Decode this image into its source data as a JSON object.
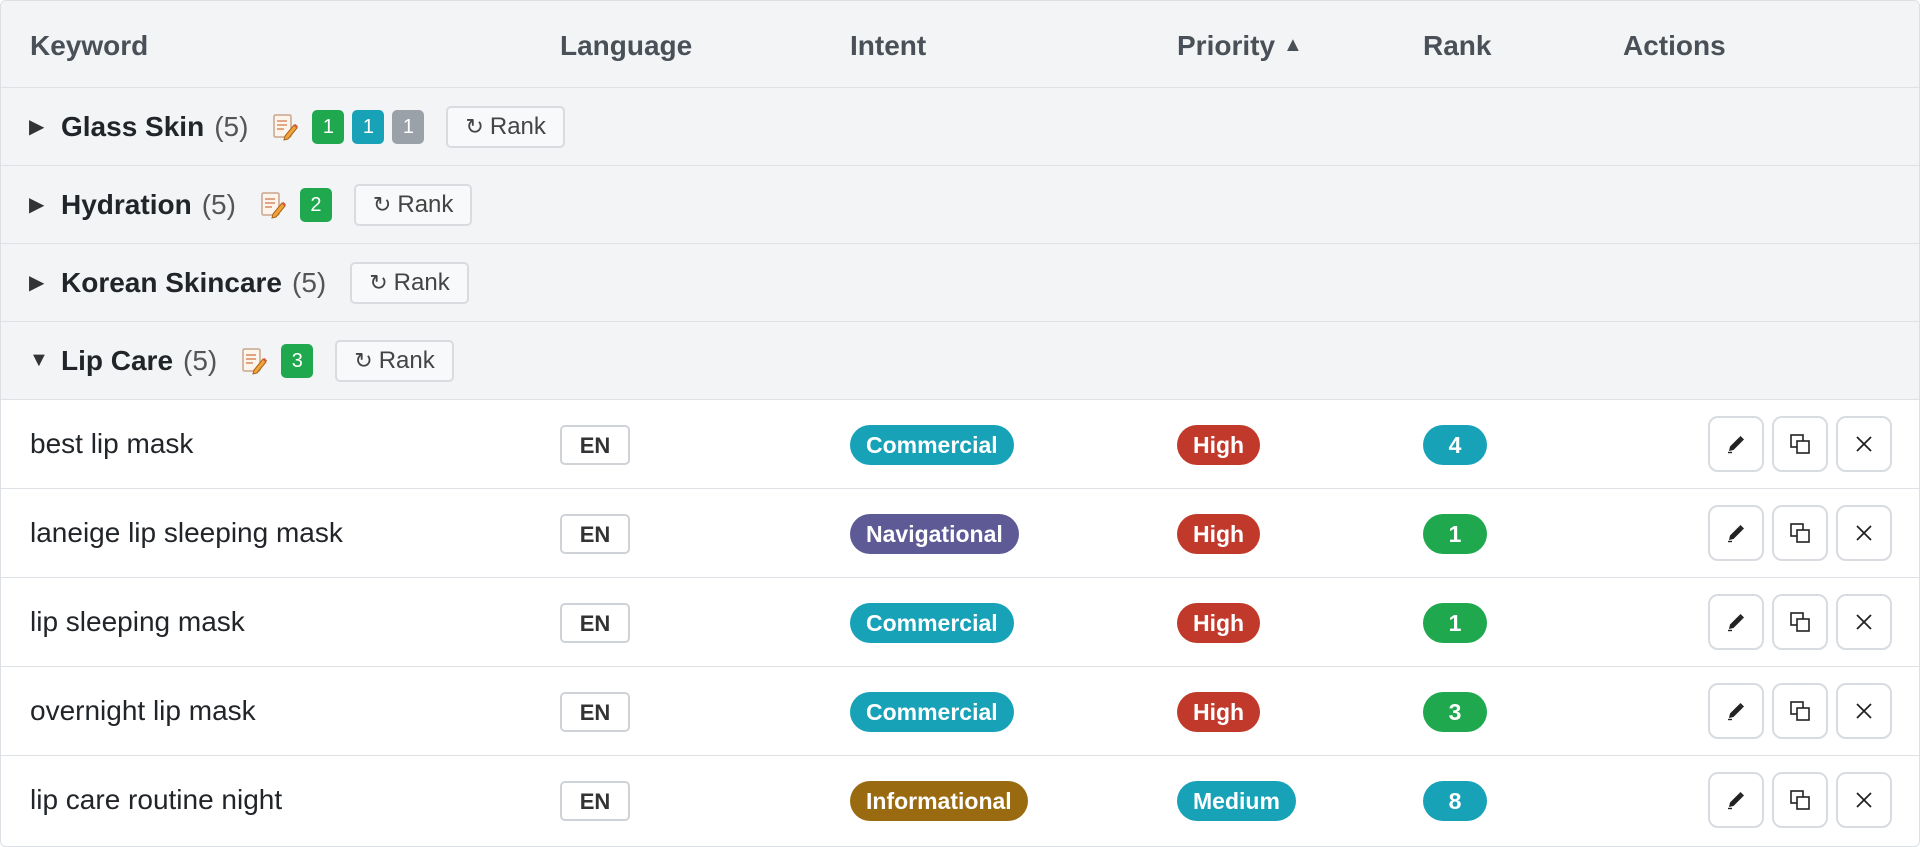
{
  "header": {
    "keyword": "Keyword",
    "language": "Language",
    "intent": "Intent",
    "priority": "Priority",
    "priority_sort_icon": "▲",
    "rank": "Rank",
    "actions": "Actions"
  },
  "groups": [
    {
      "name": "Glass Skin",
      "count": "(5)",
      "expanded": false,
      "caret": "▶",
      "rank_label": "Rank",
      "badges": [
        {
          "value": "1",
          "color": "#1fa84e"
        },
        {
          "value": "1",
          "color": "#17a2b8"
        },
        {
          "value": "1",
          "color": "#9aa1a8"
        }
      ]
    },
    {
      "name": "Hydration",
      "count": "(5)",
      "expanded": false,
      "caret": "▶",
      "rank_label": "Rank",
      "badges": [
        {
          "value": "2",
          "color": "#1fa84e"
        }
      ]
    },
    {
      "name": "Korean Skincare",
      "count": "(5)",
      "expanded": false,
      "caret": "▶",
      "rank_label": "Rank",
      "badges": []
    },
    {
      "name": "Lip Care",
      "count": "(5)",
      "expanded": true,
      "caret": "▼",
      "rank_label": "Rank",
      "badges": [
        {
          "value": "3",
          "color": "#1fa84e"
        }
      ]
    }
  ],
  "rows": [
    {
      "keyword": "best lip mask",
      "language": "EN",
      "intent": "Commercial",
      "intent_color": "#17a2b8",
      "priority": "High",
      "priority_color": "#c0392b",
      "rank": "4",
      "rank_color": "#17a2b8"
    },
    {
      "keyword": "laneige lip sleeping mask",
      "language": "EN",
      "intent": "Navigational",
      "intent_color": "#5e5a96",
      "priority": "High",
      "priority_color": "#c0392b",
      "rank": "1",
      "rank_color": "#1fa84e"
    },
    {
      "keyword": "lip sleeping mask",
      "language": "EN",
      "intent": "Commercial",
      "intent_color": "#17a2b8",
      "priority": "High",
      "priority_color": "#c0392b",
      "rank": "1",
      "rank_color": "#1fa84e"
    },
    {
      "keyword": "overnight lip mask",
      "language": "EN",
      "intent": "Commercial",
      "intent_color": "#17a2b8",
      "priority": "High",
      "priority_color": "#c0392b",
      "rank": "3",
      "rank_color": "#1fa84e"
    },
    {
      "keyword": "lip care routine night",
      "language": "EN",
      "intent": "Informational",
      "intent_color": "#9a6a10",
      "priority": "Medium",
      "priority_color": "#17a2b8",
      "rank": "8",
      "rank_color": "#17a2b8"
    }
  ],
  "icons": {
    "group_caret": "caret-icon",
    "group_note": "document-edit-icon",
    "rank_button": "refresh-icon",
    "row_actions": [
      "pencil-icon",
      "duplicate-icon",
      "close-icon"
    ]
  },
  "refresh_glyph": "↻"
}
